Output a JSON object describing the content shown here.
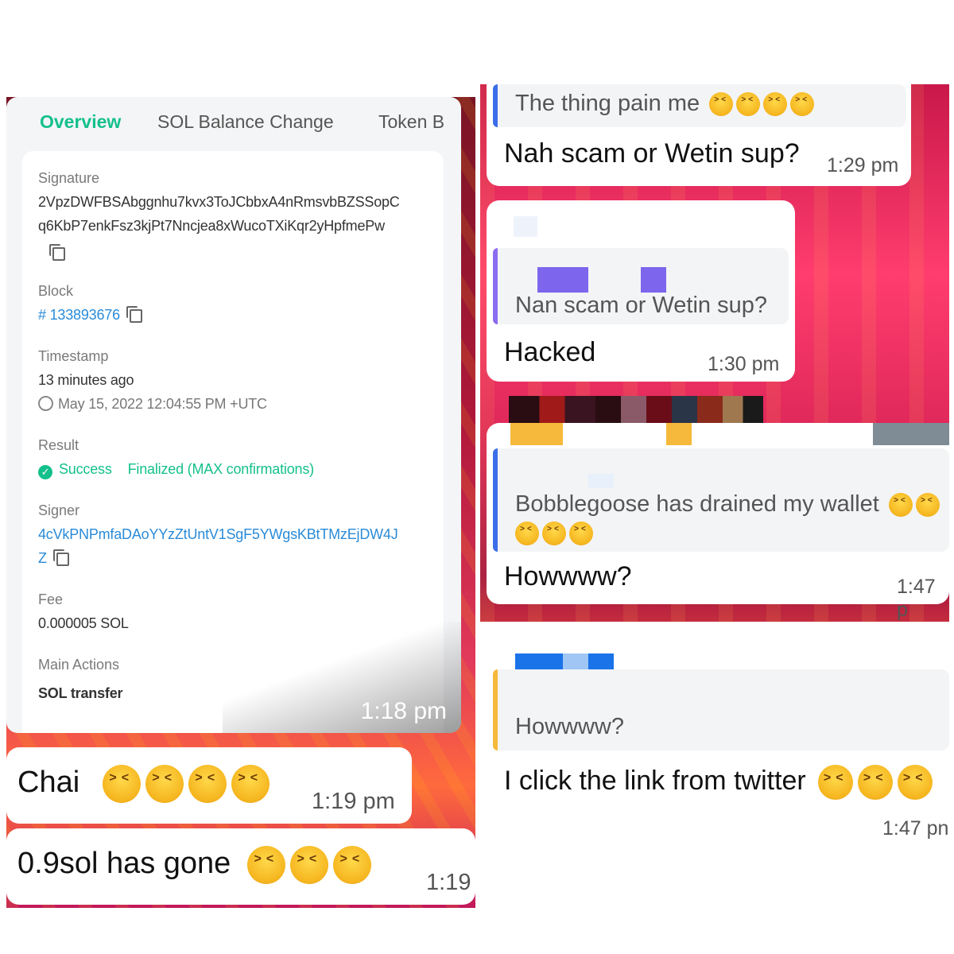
{
  "explorer": {
    "tabs": [
      "Overview",
      "SOL Balance Change",
      "Token B"
    ],
    "signature": {
      "label": "Signature",
      "line1": "2VpzDWFBSAbggnhu7kvx3ToJCbbxA4nRmsvbBZSSopC",
      "line2": "q6KbP7enkFsz3kjPt7Nncjea8xWucoTXiKqr2yHpfmePw"
    },
    "block": {
      "label": "Block",
      "value": "# 133893676"
    },
    "timestamp": {
      "label": "Timestamp",
      "relative": "13 minutes ago",
      "absolute": "May 15, 2022 12:04:55 PM +UTC"
    },
    "result": {
      "label": "Result",
      "status": "Success",
      "confirmation": "Finalized (MAX confirmations)"
    },
    "signer": {
      "label": "Signer",
      "line1": "4cVkPNPmfaDAoYYzZtUntV1SgF5YWgsKBtTMzEjDW4J",
      "line2": "Z"
    },
    "fee": {
      "label": "Fee",
      "value": "0.000005 SOL"
    },
    "main_actions": {
      "label": "Main Actions",
      "value": "SOL transfer"
    },
    "time": "1:18 pm"
  },
  "left_messages": [
    {
      "text": "Chai",
      "time": "1:19 pm",
      "emoji_count": 4
    },
    {
      "text": "0.9sol has gone",
      "time": "1:19",
      "emoji_count": 3
    }
  ],
  "right_messages": [
    {
      "quote": "The thing pain me",
      "text": "Nah scam or Wetin sup?",
      "time": "1:29 pm"
    },
    {
      "quote": "Nan scam or Wetin sup?",
      "text": "Hacked",
      "time": "1:30 pm"
    },
    {
      "quote": "Bobblegoose has drained my wallet",
      "text": "Howwww?",
      "time": "1:47 p"
    },
    {
      "quote": "Howwww?",
      "text": "I click the link from twitter",
      "time": "1:47 pn"
    }
  ],
  "colors": {
    "accent": "#14c08c",
    "link": "#2a8bd8"
  }
}
